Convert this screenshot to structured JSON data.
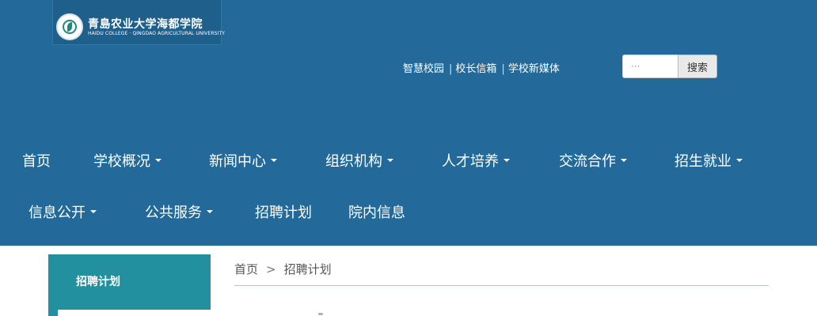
{
  "logo": {
    "name_cn": "青島农业大学海都学院",
    "name_en": "HAIDU COLLEGE · QINGDAO AGRICULTURAL UNIVERSITY"
  },
  "top_links": [
    "智慧校园",
    "校长信箱",
    "学校新媒体"
  ],
  "search": {
    "placeholder": "···",
    "button_label": "搜索"
  },
  "nav": {
    "items": [
      {
        "label": "首页",
        "dropdown": false
      },
      {
        "label": "学校概况",
        "dropdown": true
      },
      {
        "label": "新闻中心",
        "dropdown": true
      },
      {
        "label": "组织机构",
        "dropdown": true
      },
      {
        "label": "人才培养",
        "dropdown": true
      },
      {
        "label": "交流合作",
        "dropdown": true
      },
      {
        "label": "招生就业",
        "dropdown": true
      },
      {
        "label": "信息公开",
        "dropdown": true
      },
      {
        "label": "公共服务",
        "dropdown": true
      },
      {
        "label": "招聘计划",
        "dropdown": false
      },
      {
        "label": "院内信息",
        "dropdown": false
      }
    ]
  },
  "sidebar": {
    "active_label": "招聘计划"
  },
  "breadcrumb": {
    "home": "首页",
    "separator": ">",
    "current": "招聘计划"
  },
  "colors": {
    "header_bg": "#236a9b",
    "sidebar_active": "#22909e",
    "divider": "#a9cfd4"
  }
}
